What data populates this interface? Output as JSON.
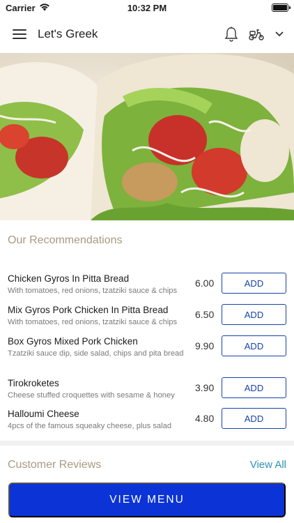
{
  "status_bar": {
    "carrier": "Carrier",
    "time": "10:32 PM",
    "battery_level": 1.0
  },
  "header": {
    "title": "Let's Greek"
  },
  "recommendations": {
    "title": "Our Recommendations",
    "items": [
      {
        "name": "Chicken Gyros In Pitta Bread",
        "description": "With tomatoes, red onions, tzatziki sauce & chips",
        "price": "6.00",
        "button": "ADD"
      },
      {
        "name": "Mix Gyros Pork Chicken In Pitta Bread",
        "description": " With tomatoes, red onions, tzatziki sauce & chips",
        "price": "6.50",
        "button": "ADD"
      },
      {
        "name": "Box Gyros Mixed Pork Chicken",
        "description": "Tzatziki sauce dip, side salad, chips and pita bread",
        "price": "9.90",
        "button": "ADD"
      },
      {
        "name": "Tirokroketes",
        "description": "Cheese stuffed croquettes with sesame & honey",
        "price": "3.90",
        "button": "ADD"
      },
      {
        "name": "Halloumi Cheese",
        "description": " 4pcs of the famous squeaky cheese, plus salad",
        "price": "4.80",
        "button": "ADD"
      }
    ]
  },
  "reviews": {
    "title": "Customer Reviews",
    "view_all": "View All"
  },
  "footer": {
    "view_menu": "VIEW MENU"
  },
  "colors": {
    "accent_blue": "#1742a8",
    "primary_button": "#0b33d6",
    "section_title": "#a99a80",
    "link": "#2a93b8"
  },
  "icons": [
    "wifi-icon",
    "battery-icon",
    "hamburger-menu-icon",
    "bell-icon",
    "scooter-icon",
    "chevron-down-icon"
  ]
}
